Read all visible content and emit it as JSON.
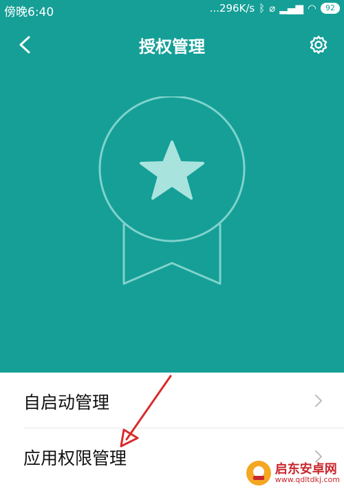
{
  "status_bar": {
    "time": "傍晚6:40",
    "network_speed": "...296K/s",
    "battery": "92",
    "icons": [
      "bluetooth-icon",
      "mute-icon",
      "hd-icon",
      "signal-icon",
      "wifi-icon",
      "battery-icon"
    ]
  },
  "header": {
    "title": "授权管理",
    "back_icon": "chevron-left-icon",
    "settings_icon": "gear-icon"
  },
  "hero": {
    "icon": "award-medal-icon",
    "background": "#159f97"
  },
  "list": {
    "items": [
      {
        "label": "自启动管理",
        "icon": "chevron-right-icon"
      },
      {
        "label": "应用权限管理",
        "icon": "chevron-right-icon"
      }
    ]
  },
  "watermark": {
    "title": "启东安卓网",
    "url": "www.qdltdkj.com"
  }
}
